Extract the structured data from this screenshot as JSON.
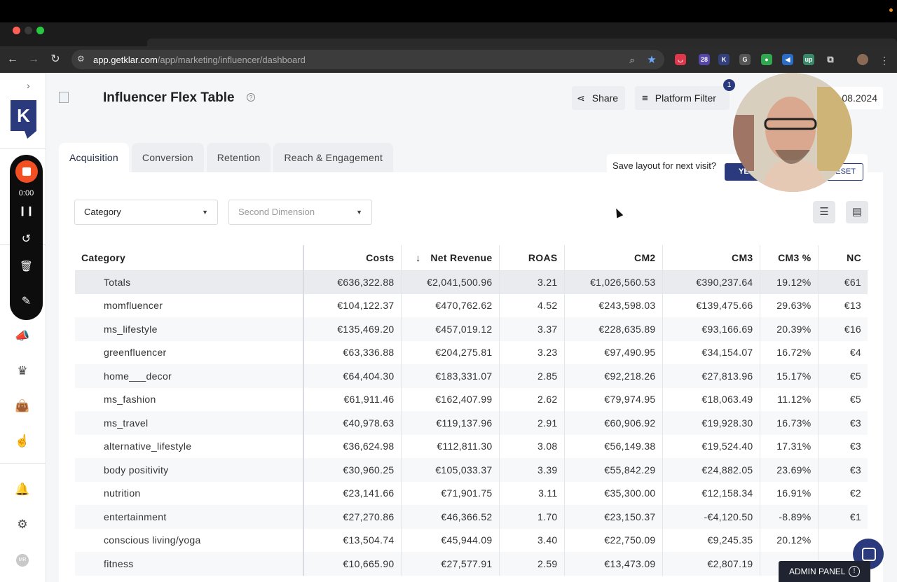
{
  "browser": {
    "url_host": "app.getklar.com",
    "url_path": "/app/marketing/influencer/dashboard",
    "ext_badge": "28"
  },
  "sidebar": {
    "logo_letter": "K",
    "recorder_time": "0:00",
    "avatar_initials": "MR"
  },
  "header": {
    "title": "Influencer Flex Table",
    "share_label": "Share",
    "platform_filter_label": "Platform Filter",
    "platform_filter_badge": "1",
    "date_text": "7.08.2024"
  },
  "tabs": [
    "Acquisition",
    "Conversion",
    "Retention",
    "Reach & Engagement"
  ],
  "save_layout": {
    "text": "Save layout for next visit?",
    "yes_label": "YES",
    "reset_label": "RESET"
  },
  "filters": {
    "dimension1": "Category",
    "dimension2_placeholder": "Second Dimension"
  },
  "table": {
    "columns": [
      "Category",
      "Costs",
      "Net Revenue",
      "ROAS",
      "CM2",
      "CM3",
      "CM3 %",
      "NC"
    ],
    "sort_icon": "arrow-down-icon",
    "rows": [
      [
        "Totals",
        "€636,322.88",
        "€2,041,500.96",
        "3.21",
        "€1,026,560.53",
        "€390,237.64",
        "19.12%",
        "€61"
      ],
      [
        "momfluencer",
        "€104,122.37",
        "€470,762.62",
        "4.52",
        "€243,598.03",
        "€139,475.66",
        "29.63%",
        "€13"
      ],
      [
        "ms_lifestyle",
        "€135,469.20",
        "€457,019.12",
        "3.37",
        "€228,635.89",
        "€93,166.69",
        "20.39%",
        "€16"
      ],
      [
        "greenfluencer",
        "€63,336.88",
        "€204,275.81",
        "3.23",
        "€97,490.95",
        "€34,154.07",
        "16.72%",
        "€4"
      ],
      [
        "home___decor",
        "€64,404.30",
        "€183,331.07",
        "2.85",
        "€92,218.26",
        "€27,813.96",
        "15.17%",
        "€5"
      ],
      [
        "ms_fashion",
        "€61,911.46",
        "€162,407.99",
        "2.62",
        "€79,974.95",
        "€18,063.49",
        "11.12%",
        "€5"
      ],
      [
        "ms_travel",
        "€40,978.63",
        "€119,137.96",
        "2.91",
        "€60,906.92",
        "€19,928.30",
        "16.73%",
        "€3"
      ],
      [
        "alternative_lifestyle",
        "€36,624.98",
        "€112,811.30",
        "3.08",
        "€56,149.38",
        "€19,524.40",
        "17.31%",
        "€3"
      ],
      [
        "body positivity",
        "€30,960.25",
        "€105,033.37",
        "3.39",
        "€55,842.29",
        "€24,882.05",
        "23.69%",
        "€3"
      ],
      [
        "nutrition",
        "€23,141.66",
        "€71,901.75",
        "3.11",
        "€35,300.00",
        "€12,158.34",
        "16.91%",
        "€2"
      ],
      [
        "entertainment",
        "€27,270.86",
        "€46,366.52",
        "1.70",
        "€23,150.37",
        "-€4,120.50",
        "-8.89%",
        "€1"
      ],
      [
        "conscious living/yoga",
        "€13,504.74",
        "€45,944.09",
        "3.40",
        "€22,750.09",
        "€9,245.35",
        "20.12%",
        ""
      ],
      [
        "fitness",
        "€10,665.90",
        "€27,577.91",
        "2.59",
        "€13,473.09",
        "€2,807.19",
        "",
        ""
      ]
    ]
  },
  "admin_panel_label": "ADMIN PANEL",
  "colors": {
    "brand": "#2b3a7c",
    "record": "#f25022"
  }
}
